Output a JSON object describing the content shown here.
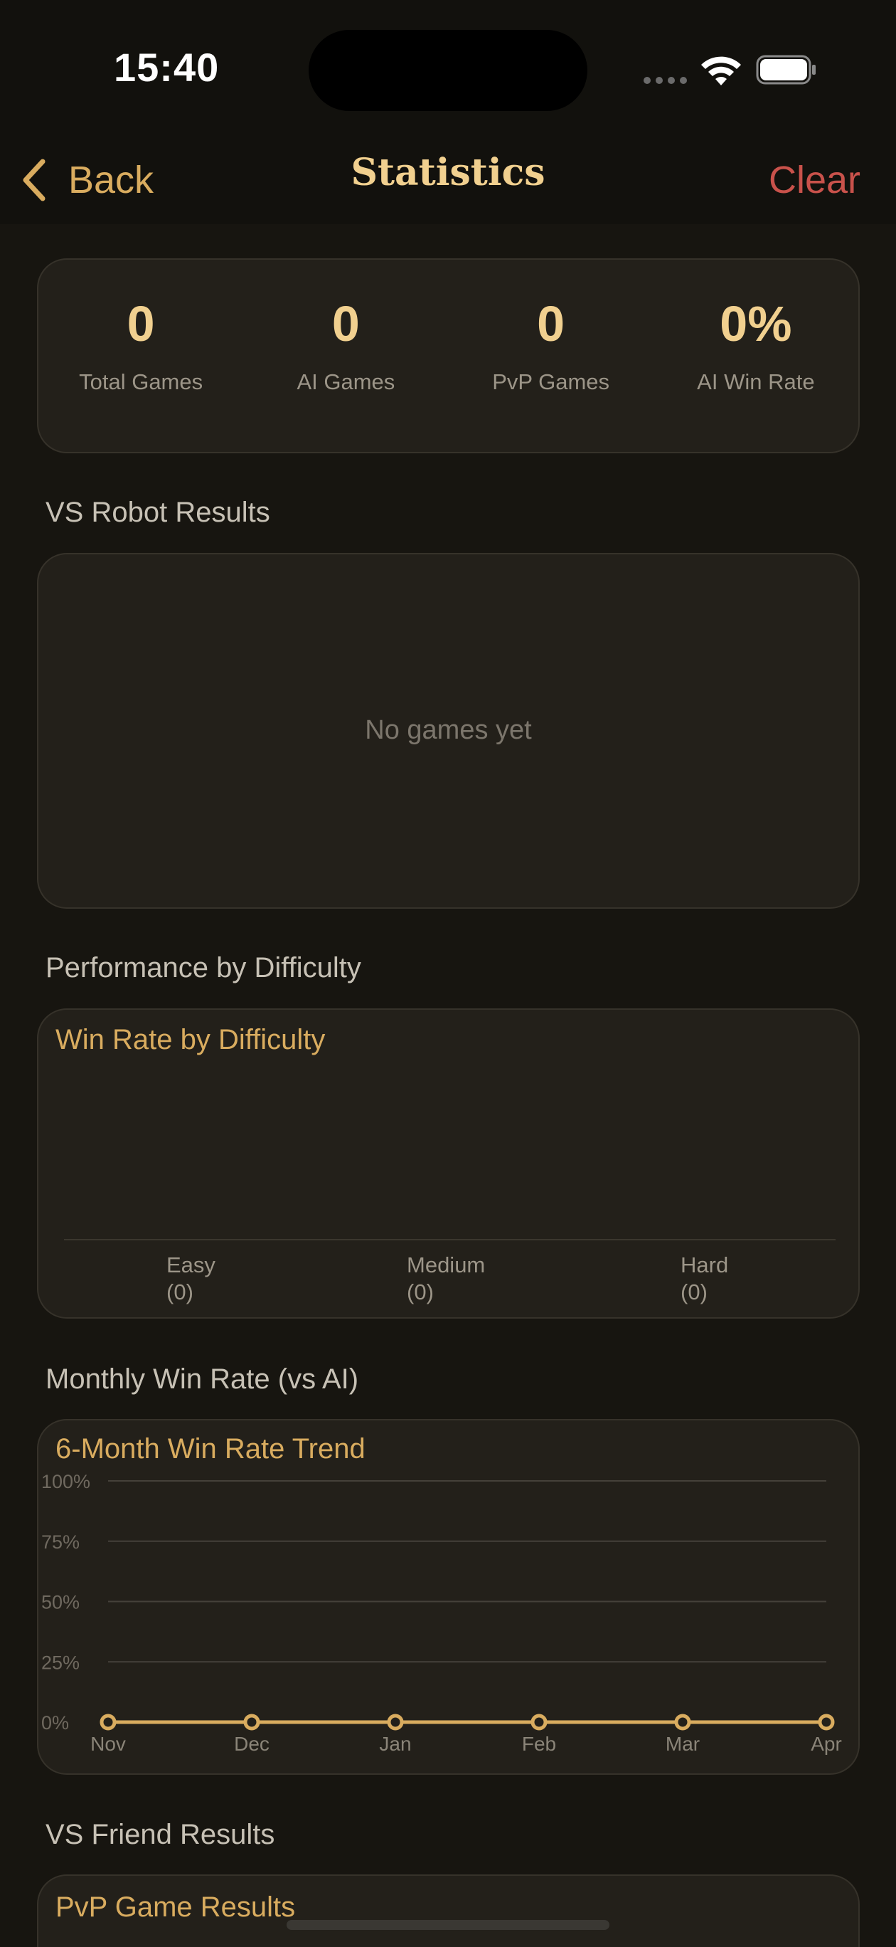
{
  "status": {
    "time": "15:40"
  },
  "nav": {
    "back_label": "Back",
    "title": "Statistics",
    "clear_label": "Clear"
  },
  "summary": [
    {
      "value": "0",
      "label": "Total Games"
    },
    {
      "value": "0",
      "label": "AI Games"
    },
    {
      "value": "0",
      "label": "PvP Games"
    },
    {
      "value": "0%",
      "label": "AI Win Rate"
    }
  ],
  "robot_section": {
    "heading": "VS Robot Results",
    "empty_text": "No games yet"
  },
  "difficulty_section": {
    "heading": "Performance by Difficulty",
    "card_title": "Win Rate by Difficulty"
  },
  "monthly_section": {
    "heading": "Monthly Win Rate (vs AI)",
    "card_title": "6-Month Win Rate Trend"
  },
  "friend_section": {
    "heading": "VS Friend Results",
    "card_title": "PvP Game Results"
  },
  "colors": {
    "accent": "#d9ac5f",
    "title": "#f1d08f",
    "destructive": "#c9524b",
    "card": "#23201a"
  },
  "chart_data": [
    {
      "type": "bar",
      "title": "Win Rate by Difficulty",
      "categories": [
        "Easy",
        "Medium",
        "Hard"
      ],
      "category_labels": [
        "Easy\n(0)",
        "Medium\n(0)",
        "Hard\n(0)"
      ],
      "values": [
        0,
        0,
        0
      ]
    },
    {
      "type": "line",
      "title": "6-Month Win Rate Trend",
      "x": [
        "Nov",
        "Dec",
        "Jan",
        "Feb",
        "Mar",
        "Apr"
      ],
      "series": [
        {
          "values": [
            0,
            0,
            0,
            0,
            0,
            0
          ]
        }
      ],
      "yticks": [
        "0%",
        "25%",
        "50%",
        "75%",
        "100%"
      ],
      "ylim": [
        0,
        100
      ],
      "grid": true
    }
  ]
}
